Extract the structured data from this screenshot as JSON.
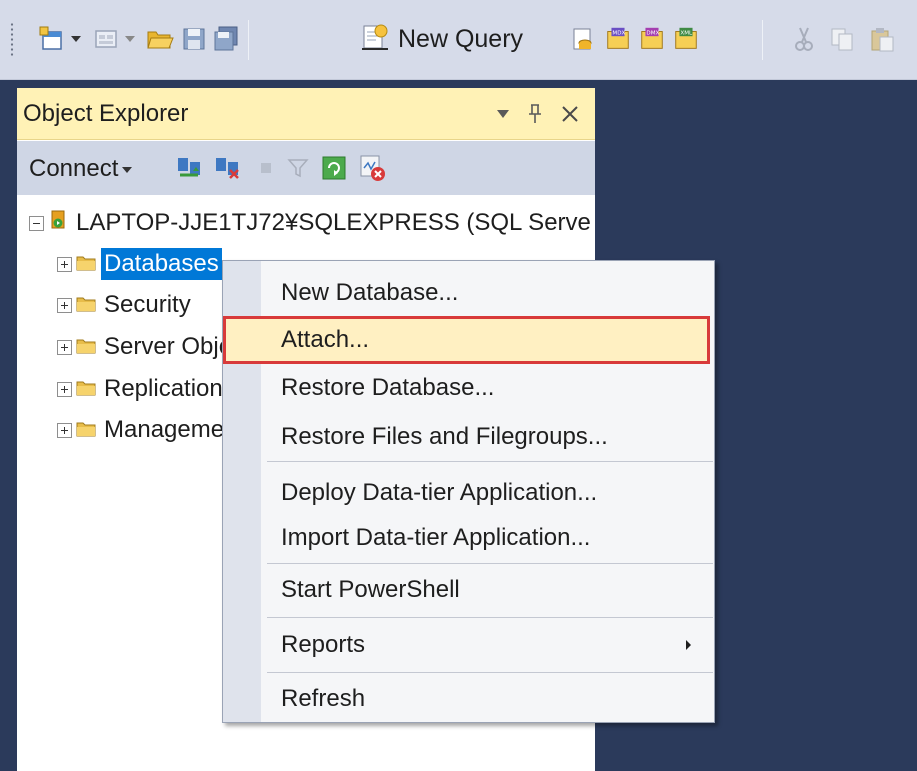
{
  "toolbar": {
    "new_query_label": "New Query",
    "icons": [
      "new-project-icon",
      "add-item-icon",
      "open-file-icon",
      "save-icon",
      "save-all-icon",
      "new-query-icon",
      "database-engine-query-icon",
      "mdx-query-icon",
      "dmx-query-icon",
      "xmla-query-icon",
      "cut-icon",
      "copy-icon",
      "paste-icon"
    ]
  },
  "object_explorer": {
    "title": "Object Explorer",
    "connect_label": "Connect",
    "tree": {
      "server": "LAPTOP-JJE1TJ72¥SQLEXPRESS (SQL Serve",
      "nodes": [
        {
          "label": "Databases",
          "selected": true
        },
        {
          "label": "Security"
        },
        {
          "label": "Server Objects"
        },
        {
          "label": "Replication"
        },
        {
          "label": "Management"
        }
      ]
    }
  },
  "context_menu": {
    "groups": [
      [
        "New Database...",
        "Attach...",
        "Restore Database...",
        "Restore Files and Filegroups..."
      ],
      [
        "Deploy Data-tier Application...",
        "Import Data-tier Application..."
      ],
      [
        "Start PowerShell"
      ],
      [
        "Reports"
      ],
      [
        "Refresh"
      ]
    ],
    "highlighted": "Attach...",
    "highlight_color": "#d83a3a"
  },
  "colors": {
    "background": "#2b3a5b",
    "toolbar": "#d6dbe9",
    "explorer_title": "#fff2b6",
    "selection": "#0078d7"
  }
}
